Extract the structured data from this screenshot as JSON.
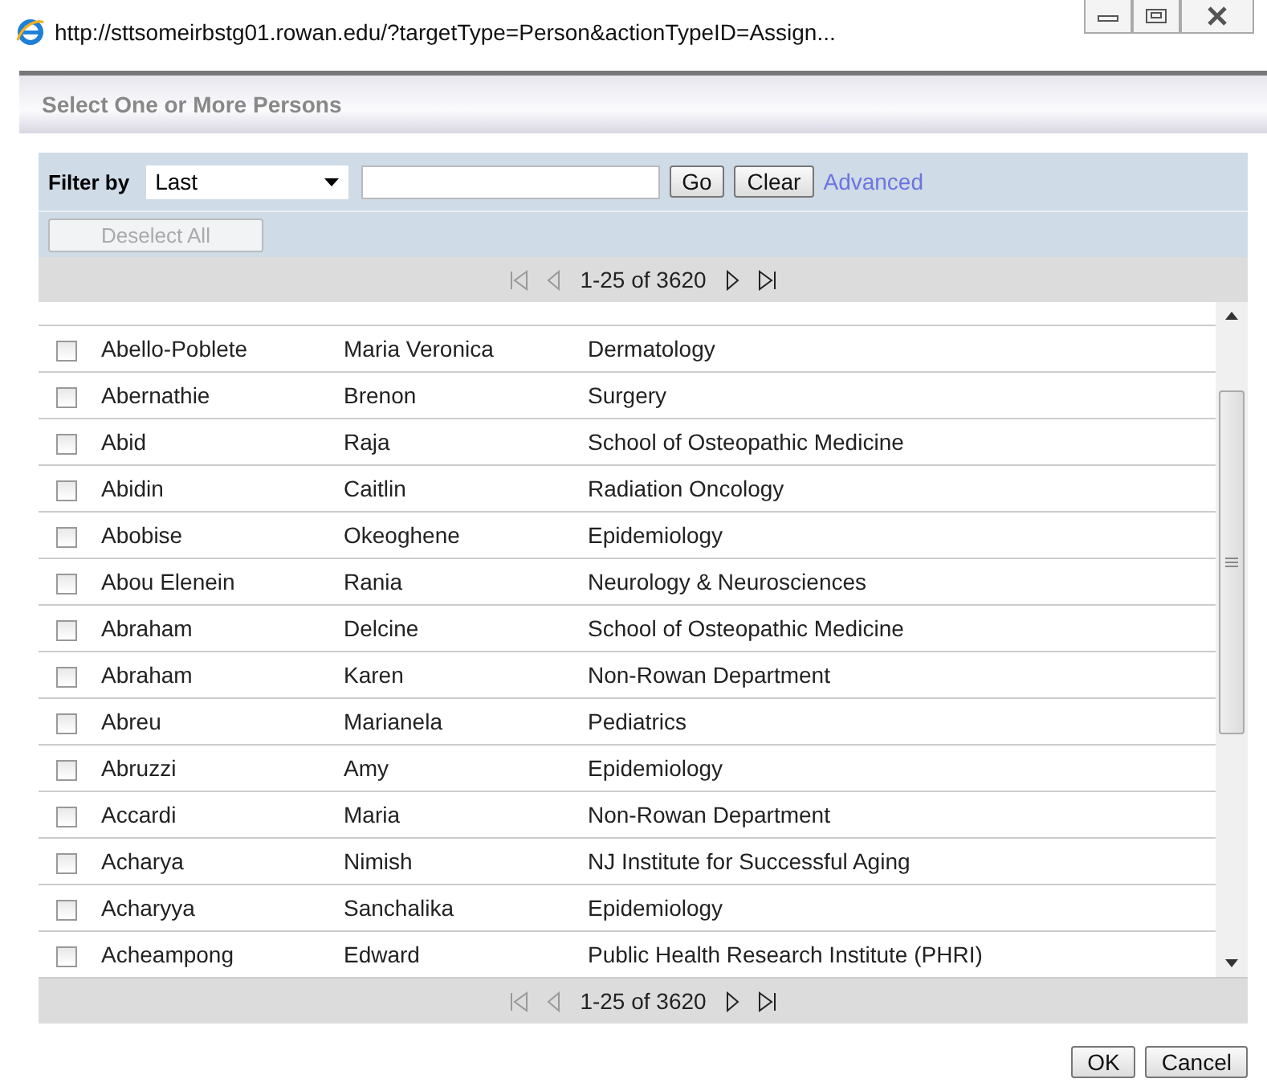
{
  "window": {
    "address": "http://sttsomeirbstg01.rowan.edu/?targetType=Person&actionTypeID=Assign..."
  },
  "dialog": {
    "title": "Select One or More Persons"
  },
  "filter": {
    "label": "Filter by",
    "field": "Last",
    "go": "Go",
    "clear": "Clear",
    "advanced": "Advanced"
  },
  "deselect_all": {
    "label": "Deselect All",
    "disabled": true
  },
  "pager_top": {
    "range": "1-25 of 3620"
  },
  "rows": [
    {
      "last": "Abello-Poblete",
      "first": "Maria Veronica",
      "department": "Dermatology",
      "checked": false
    },
    {
      "last": "Abernathie",
      "first": "Brenon",
      "department": "Surgery",
      "checked": false
    },
    {
      "last": "Abid",
      "first": "Raja",
      "department": "School of Osteopathic Medicine",
      "checked": false
    },
    {
      "last": "Abidin",
      "first": "Caitlin",
      "department": "Radiation Oncology",
      "checked": false
    },
    {
      "last": "Abobise",
      "first": "Okeoghene",
      "department": "Epidemiology",
      "checked": false
    },
    {
      "last": "Abou Elenein",
      "first": "Rania",
      "department": "Neurology & Neurosciences",
      "checked": false
    },
    {
      "last": "Abraham",
      "first": "Delcine",
      "department": "School of Osteopathic Medicine",
      "checked": false
    },
    {
      "last": "Abraham",
      "first": "Karen",
      "department": "Non-Rowan Department",
      "checked": false
    },
    {
      "last": "Abreu",
      "first": "Marianela",
      "department": "Pediatrics",
      "checked": false
    },
    {
      "last": "Abruzzi",
      "first": "Amy",
      "department": "Epidemiology",
      "checked": false
    },
    {
      "last": "Accardi",
      "first": "Maria",
      "department": "Non-Rowan Department",
      "checked": false
    },
    {
      "last": "Acharya",
      "first": "Nimish",
      "department": "NJ Institute for Successful Aging",
      "checked": false
    },
    {
      "last": "Acharyya",
      "first": "Sanchalika",
      "department": "Epidemiology",
      "checked": false
    },
    {
      "last": "Acheampong",
      "first": "Edward",
      "department": "Public Health Research Institute (PHRI)",
      "checked": false
    }
  ],
  "pager_bottom": {
    "range": "1-25 of 3620"
  },
  "buttons": [
    {
      "label": "OK"
    },
    {
      "label": "Cancel"
    }
  ]
}
